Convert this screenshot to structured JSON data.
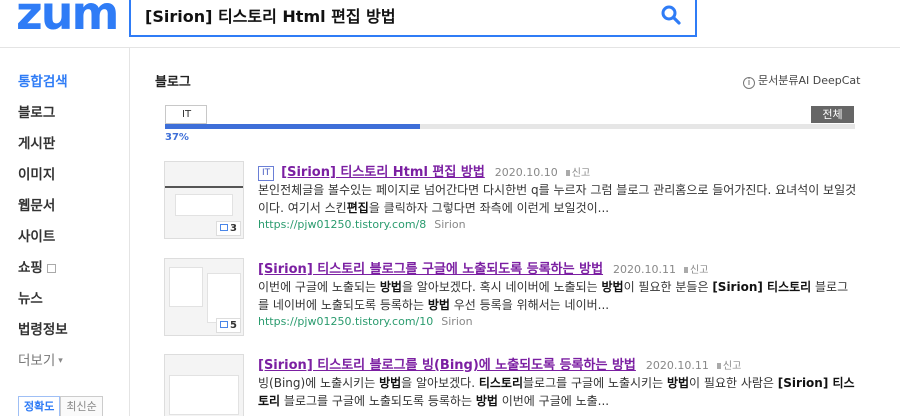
{
  "header": {
    "logo": "zum",
    "search_query": "[Sirion] 티스토리 Html 편집 방법"
  },
  "lnb": {
    "items": [
      {
        "label": "통합검색"
      },
      {
        "label": "블로그"
      },
      {
        "label": "게시판"
      },
      {
        "label": "이미지"
      },
      {
        "label": "웹문서"
      },
      {
        "label": "사이트"
      },
      {
        "label": "쇼핑"
      },
      {
        "label": "뉴스"
      },
      {
        "label": "법령정보"
      },
      {
        "label": "더보기"
      }
    ],
    "sort": [
      "정확도",
      "최신순"
    ]
  },
  "section": {
    "title": "블로그",
    "deepcat": "문서분류AI DeepCat",
    "info_glyph": "i",
    "category_tab": "IT",
    "all_label": "전체",
    "percent_label": "37%",
    "percent_value": 0.37
  },
  "results": [
    {
      "badge": "IT",
      "title": "[Sirion] 티스토리 Html 편집 방법",
      "date": "2020.10.10",
      "report": "신고",
      "desc_html": "본인전체글을 볼수있는 페이지로 넘어간다면 다시한번 q를 누르자 그럼 블로그 관리홈으로 들어가진다. 요녀석이 보일것이다. 여기서 스킨<b>편집</b>을 클릭하자 그렇다면 좌측에 이런게 보일것이...",
      "url": "https://pjw01250.tistory.com/8",
      "author": "Sirion",
      "image_count": "3"
    },
    {
      "badge": "",
      "title": "[Sirion] 티스토리 블로그를 구글에 노출되도록 등록하는 방법",
      "date": "2020.10.11",
      "report": "신고",
      "desc_html": "이번에 구글에 노출되는 <b>방법</b>을 알아보겠다. 혹시 네이버에 노출되는 <b>방법</b>이 필요한 분들은 <b>[Sirion] 티스토리</b> 블로그를 네이버에 노출되도록 등록하는 <b>방법</b> 우선 등록을 위해서는 네이버...",
      "url": "https://pjw01250.tistory.com/10",
      "author": "Sirion",
      "image_count": "5"
    },
    {
      "badge": "",
      "title": "[Sirion] 티스토리 블로그를 빙(Bing)에 노출되도록 등록하는 방법",
      "date": "2020.10.11",
      "report": "신고",
      "desc_html": "빙(Bing)에 노출시키는 <b>방법</b>을 알아보겠다. <b>티스토리</b>블로그를 구글에 노출시키는 <b>방법</b>이 필요한 사람은 <b>[Sirion] 티스토리</b> 블로그를 구글에 노출되도록 등록하는 <b>방법</b> 이번에 구글에 노출...",
      "url": "",
      "author": "",
      "image_count": ""
    }
  ],
  "colors": {
    "brand": "#2f7cf6",
    "visited_link": "#7b1fa2",
    "url_green": "#2a9b6e",
    "progress": "#3e6fd8"
  }
}
